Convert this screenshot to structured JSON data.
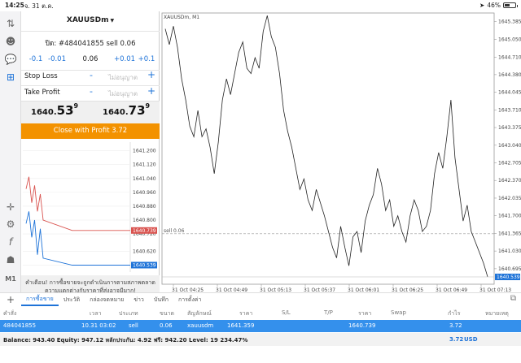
{
  "status_bar": {
    "time": "14:25",
    "date": "จ. 31 ต.ค.",
    "battery": "46%",
    "battery_level": 0.46
  },
  "panel": {
    "symbol": "XAUUSDm",
    "order_title": "ปิด: #484041855 sell 0.06",
    "steppers": [
      "-0.1",
      "-0.01",
      "0.06",
      "+0.01",
      "+0.1"
    ],
    "stop_loss_label": "Stop Loss",
    "take_profit_label": "Take Profit",
    "sl_placeholder": "ไม่อนุญาต",
    "tp_placeholder": "ไม่อนุญาต",
    "minus": "-",
    "plus": "+",
    "bid_prefix": "1640.",
    "bid_big": "53",
    "bid_sup": "9",
    "ask_prefix": "1640.",
    "ask_big": "73",
    "ask_sup": "9",
    "close_button": "Close with Profit 3.72",
    "warning": "คำเตือน! การซื้อขายจะถูกดำเนินการตามสภาพตลาด ความแตกต่างกับราคาที่ส่งอาจมีมาก!",
    "mini_axis": [
      "1641.200",
      "1641.120",
      "1641.040",
      "1640.960",
      "1640.880",
      "1640.800",
      "1640.720",
      "1640.620",
      "1640.540"
    ],
    "tag_ask": "1640.739",
    "tag_bid": "1640.539"
  },
  "toolbar": {
    "m1_label": "M1"
  },
  "chart": {
    "title": "XAUUSDm, M1",
    "order_line_label": "sell 0.06",
    "current_price_tag": "1640.539",
    "colors": {
      "line": "#222222",
      "grid": "#e6e6e6",
      "order_line": "#999999",
      "price_tag": "#1e73d8"
    }
  },
  "chart_data": {
    "type": "line",
    "title": "XAUUSDm, M1",
    "y_ticks": [
      "1645.385",
      "1645.050",
      "1644.710",
      "1644.380",
      "1644.045",
      "1643.710",
      "1643.375",
      "1643.040",
      "1642.705",
      "1642.370",
      "1642.035",
      "1641.700",
      "1641.365",
      "1641.030",
      "1640.695"
    ],
    "x_ticks": [
      "31 Oct 04:25",
      "31 Oct 04:49",
      "31 Oct 05:13",
      "31 Oct 05:37",
      "31 Oct 06:01",
      "31 Oct 06:25",
      "31 Oct 06:49",
      "31 Oct 07:13"
    ],
    "ylim": [
      1640.4,
      1645.55
    ],
    "order_price": 1641.359,
    "current_price": 1640.539,
    "series": [
      {
        "values": [
          1645.25,
          1644.95,
          1645.3,
          1644.9,
          1644.3,
          1643.9,
          1643.4,
          1643.2,
          1643.7,
          1643.2,
          1643.35,
          1643.0,
          1642.5,
          1643.1,
          1643.9,
          1644.3,
          1644.0,
          1644.4,
          1644.8,
          1645.0,
          1644.5,
          1644.4,
          1644.7,
          1644.5,
          1645.2,
          1645.5,
          1645.1,
          1644.9,
          1644.4,
          1643.7,
          1643.3,
          1643.0,
          1642.6,
          1642.2,
          1642.4,
          1642.0,
          1641.8,
          1642.2,
          1641.95,
          1641.7,
          1641.4,
          1641.1,
          1640.9,
          1641.5,
          1641.1,
          1640.75,
          1641.3,
          1641.4,
          1641.0,
          1641.6,
          1641.9,
          1642.1,
          1642.6,
          1642.3,
          1641.8,
          1642.0,
          1641.5,
          1641.7,
          1641.4,
          1641.2,
          1641.7,
          1642.0,
          1641.8,
          1641.4,
          1641.5,
          1641.8,
          1642.5,
          1642.9,
          1642.6,
          1643.2,
          1643.9,
          1642.8,
          1642.2,
          1641.6,
          1641.9,
          1641.4,
          1641.2,
          1641.0,
          1640.8,
          1640.54
        ]
      }
    ],
    "mini_chart": {
      "ylim": [
        1640.5,
        1641.25
      ],
      "ask": [
        1640.98,
        1641.05,
        1640.9,
        1641.0,
        1640.85,
        1640.95,
        1640.8,
        1640.74,
        1640.74,
        1640.74
      ],
      "bid": [
        1640.78,
        1640.85,
        1640.7,
        1640.8,
        1640.6,
        1640.75,
        1640.58,
        1640.54,
        1640.54,
        1640.54
      ],
      "ask_color": "#d9534f",
      "bid_color": "#1e73d8"
    }
  },
  "tabs": [
    "การซื้อขาย",
    "ประวัติ",
    "กล่องจดหมาย",
    "ข่าว",
    "บันทึก",
    "การตั้งค่า"
  ],
  "table": {
    "headers": [
      "คำสั่ง",
      "เวลา",
      "ประเภท",
      "ขนาด",
      "สัญลักษณ์",
      "ราคา",
      "S/L",
      "T/P",
      "ราคา",
      "Swap",
      "กำไร",
      "หมายเหตุ"
    ],
    "row": [
      "484041855",
      "10.31 03:02",
      "sell",
      "0.06",
      "xauusdm",
      "1641.359",
      "",
      "",
      "1640.739",
      "",
      "3.72",
      ""
    ]
  },
  "balance": {
    "text": "Balance: 943.40 Equity: 947.12 หลักประกัน: 4.92 ฟรี: 942.20 Level: 19 234.47%",
    "profit": "3.72",
    "currency": "USD"
  }
}
